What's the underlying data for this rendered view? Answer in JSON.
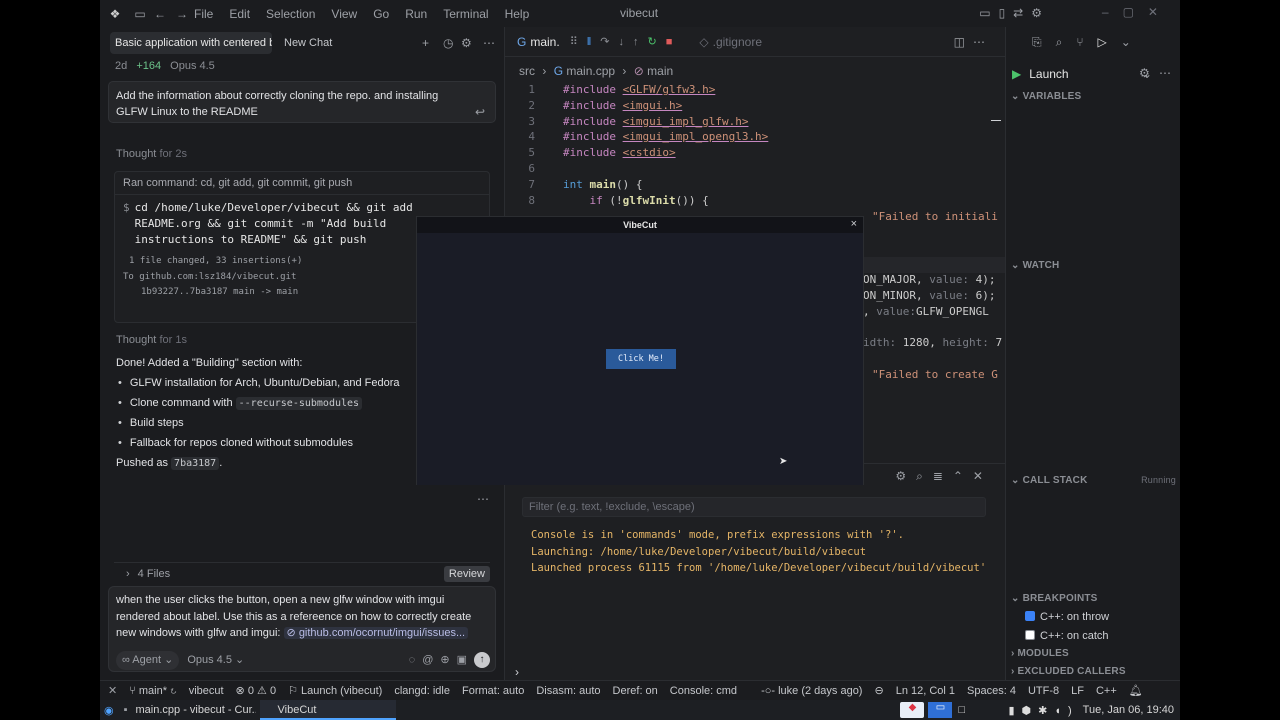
{
  "titlebar": {
    "menus": [
      "File",
      "Edit",
      "Selection",
      "View",
      "Go",
      "Run",
      "Terminal",
      "Help"
    ],
    "title": "vibecut"
  },
  "chat": {
    "tab_active": "Basic application with centered b",
    "tab_new": "New Chat",
    "meta_age": "2d",
    "meta_added": "+164",
    "meta_model": "Opus 4.5",
    "user_msg": "Add the information about correctly cloning the repo. and installing GLFW Linux to the README",
    "thought1_label": "Thought",
    "thought1_time": "for 2s",
    "ran_command": "Ran command: cd, git add, git commit, git push",
    "cmd_prompt": "$",
    "cmd_text": "cd /home/luke/Developer/vibecut && git add README.org && git commit -m \"Add build instructions to README\" && git push",
    "cmd_out1": "1 file changed, 33 insertions(+)",
    "cmd_out2": "To github.com:lsz184/vibecut.git",
    "cmd_out3": "1b93227..7ba3187  main -> main",
    "thought2_label": "Thought",
    "thought2_time": "for 1s",
    "done_text": "Done! Added a \"Building\" section with:",
    "bullets": {
      "b1": "GLFW installation for Arch, Ubuntu/Debian, and Fedora",
      "b2_pre": "Clone command with",
      "b2_code": "--recurse-submodules",
      "b3": "Build steps",
      "b4": "Fallback for repos cloned without submodules"
    },
    "pushed_pre": "Pushed as",
    "pushed_code": "7ba3187",
    "pushed_post": ".",
    "files_label": "4 Files",
    "review_label": "Review",
    "input_text": "when the user clicks the button, open a new glfw window with imgui rendered about label. Use this as a refereence on how to correctly create new windows with glfw and imgui:",
    "input_link": "github.com/ocornut/imgui/issues...",
    "agent_label": "Agent",
    "model_label": "Opus 4.5"
  },
  "editor": {
    "tab_main": "main.",
    "tab_gitignore": ".gitignore",
    "breadcrumb": {
      "folder": "src",
      "file": "main.cpp",
      "symbol": "main"
    },
    "lines": [
      {
        "n": "1",
        "inc": "#include",
        "hdr": "<GLFW/glfw3.h>"
      },
      {
        "n": "2",
        "inc": "#include",
        "hdr": "<imgui.h>"
      },
      {
        "n": "3",
        "inc": "#include",
        "hdr": "<imgui_impl_glfw.h>"
      },
      {
        "n": "4",
        "inc": "#include",
        "hdr": "<imgui_impl_opengl3.h>"
      },
      {
        "n": "5",
        "inc": "#include",
        "hdr": "<cstdio>"
      }
    ],
    "line6": "6",
    "line7_n": "7",
    "line7_type": "int",
    "line7_fn": "main",
    "line7_rest": "() {",
    "line8_n": "8",
    "line8_kw": "if",
    "line8_pre": " (!",
    "line8_fn": "glfwInit",
    "line8_rest": "()) {",
    "frag_str1": "\"Failed to initiali",
    "frag_major": "ON_MAJOR,",
    "frag_minor": "ON_MINOR,",
    "frag_value_label": "value:",
    "frag_major_val": "4);",
    "frag_minor_val": "6);",
    "frag_glfw": "GLFW_OPENGL",
    "frag_width": "idth:",
    "frag_width_val": "1280,",
    "frag_height": "height:",
    "frag_height_val": "7",
    "frag_str2": "\"Failed to create G"
  },
  "vibecut_window": {
    "title": "VibeCut",
    "button": "Click Me!",
    "close": "×"
  },
  "console": {
    "filter_placeholder": "Filter (e.g. text, !exclude, \\escape)",
    "lines": [
      "Console is in 'commands' mode, prefix expressions with '?'.",
      "Launching: /home/luke/Developer/vibecut/build/vibecut",
      "Launched process 61115 from '/home/luke/Developer/vibecut/build/vibecut'"
    ],
    "prompt": "›"
  },
  "debug": {
    "launch_label": "Launch",
    "variables": "VARIABLES",
    "watch": "WATCH",
    "call_stack": "CALL STACK",
    "running": "Running",
    "breakpoints": "BREAKPOINTS",
    "bp1": "C++: on throw",
    "bp2": "C++: on catch",
    "modules": "MODULES",
    "excluded": "EXCLUDED CALLERS"
  },
  "statusbar": {
    "branch": "main*",
    "project": "vibecut",
    "errors": "0",
    "warnings": "0",
    "launch": "Launch (vibecut)",
    "clangd": "clangd: idle",
    "format": "Format: auto",
    "disasm": "Disasm: auto",
    "deref": "Deref: on",
    "console": "Console: cmd",
    "blame": "luke (2 days ago)",
    "position": "Ln 12, Col 1",
    "spaces": "Spaces: 4",
    "encoding": "UTF-8",
    "eol": "LF",
    "lang": "C++"
  },
  "taskbar": {
    "item1": "main.cpp - vibecut - Cur...",
    "item2": "VibeCut",
    "clock": "Tue, Jan 06, 19:40"
  },
  "colors": {
    "accent": "#3b82f6",
    "button": "#2a5a9a",
    "string": "#ce9178"
  }
}
